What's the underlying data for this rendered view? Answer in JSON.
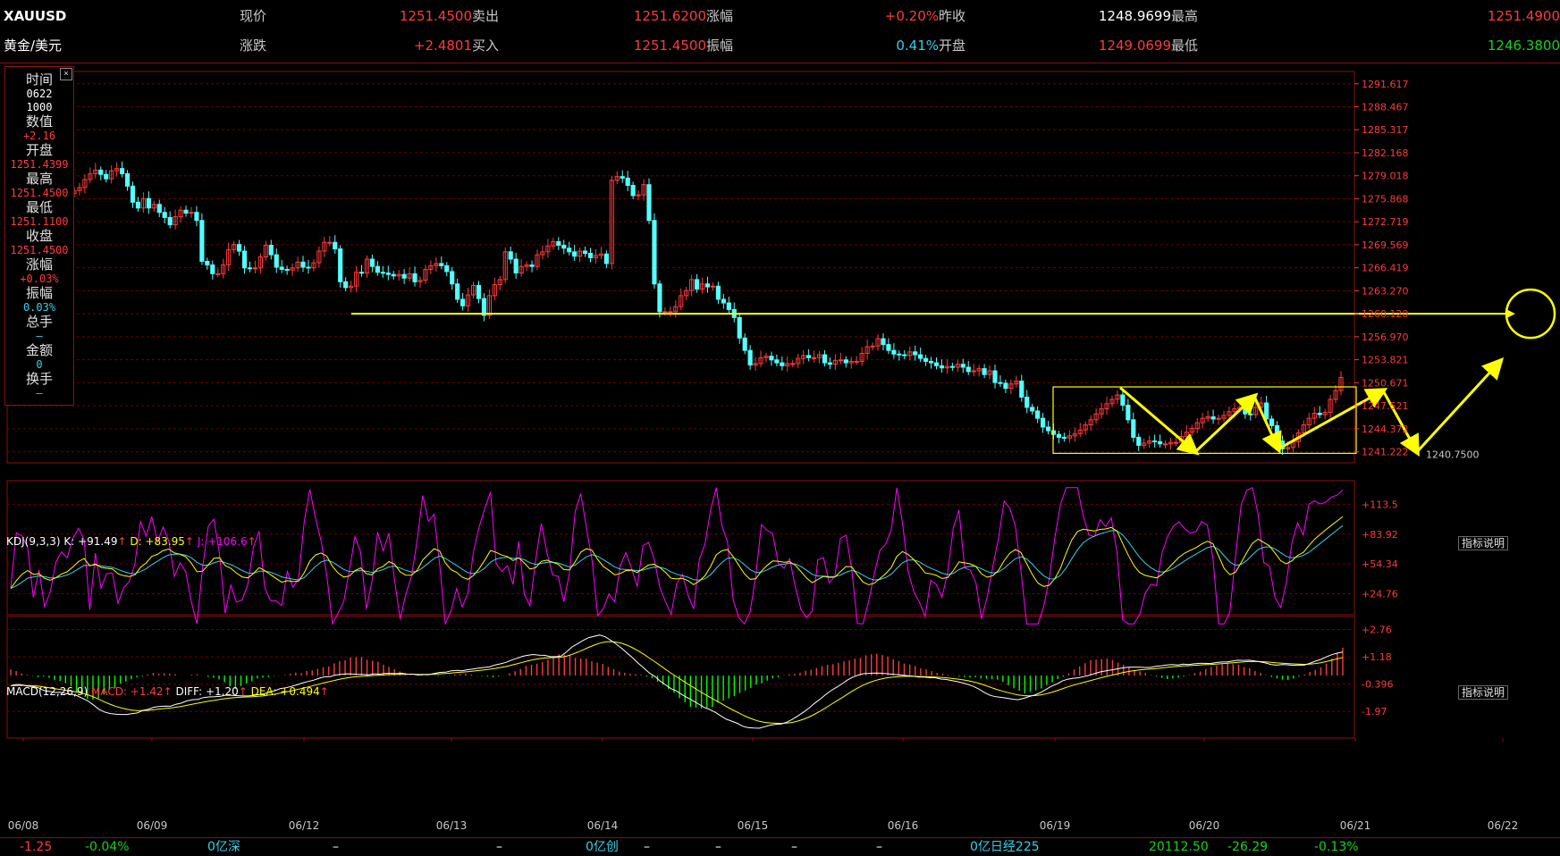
{
  "header": {
    "symbol": "XAUUSD",
    "name": "黄金/美元",
    "row1": [
      {
        "label": "现价",
        "value": "1251.4500",
        "color": "red"
      },
      {
        "label": "卖出",
        "value": "1251.6200",
        "color": "red"
      },
      {
        "label": "涨幅",
        "value": "+0.20%",
        "color": "red"
      },
      {
        "label": "昨收",
        "value": "1248.9699",
        "color": "white"
      },
      {
        "label": "最高",
        "value": "1251.4900",
        "color": "red"
      }
    ],
    "row2": [
      {
        "label": "涨跌",
        "value": "+2.4801",
        "color": "red"
      },
      {
        "label": "买入",
        "value": "1251.4500",
        "color": "red"
      },
      {
        "label": "振幅",
        "value": "0.41%",
        "color": "cyan"
      },
      {
        "label": "开盘",
        "value": "1249.0699",
        "color": "red"
      },
      {
        "label": "最低",
        "value": "1246.3800",
        "color": "green"
      }
    ]
  },
  "infobox": {
    "close_symbol": "×",
    "items": [
      {
        "label": "时间",
        "values": [
          "0622",
          "1000"
        ],
        "color": "white"
      },
      {
        "label": "数值",
        "values": [
          "+2.16"
        ],
        "color": "red"
      },
      {
        "label": "开盘",
        "values": [
          "1251.4399"
        ],
        "color": "red"
      },
      {
        "label": "最高",
        "values": [
          "1251.4500"
        ],
        "color": "red"
      },
      {
        "label": "最低",
        "values": [
          "1251.1100"
        ],
        "color": "red"
      },
      {
        "label": "收盘",
        "values": [
          "1251.4500"
        ],
        "color": "red"
      },
      {
        "label": "涨幅",
        "values": [
          "+0.03%"
        ],
        "color": "red"
      },
      {
        "label": "振幅",
        "values": [
          "0.03%"
        ],
        "color": "cyan"
      },
      {
        "label": "总手",
        "values": [
          "—"
        ],
        "color": "cyan"
      },
      {
        "label": "金额",
        "values": [
          "0"
        ],
        "color": "cyan"
      },
      {
        "label": "换手",
        "values": [
          "—"
        ],
        "color": "cyan"
      }
    ]
  },
  "chart_data": {
    "type": "candlestick",
    "price_axis_ticks": [
      "1291.617",
      "1288.467",
      "1285.317",
      "1282.168",
      "1279.018",
      "1275.868",
      "1272.719",
      "1269.569",
      "1266.419",
      "1263.270",
      "1260.120",
      "1256.970",
      "1253.821",
      "1250.671",
      "1247.521",
      "1244.372",
      "1241.222"
    ],
    "ylim": [
      1239.7,
      1293.3
    ],
    "dates": [
      "06/08",
      "06/09",
      "06/12",
      "06/13",
      "06/14",
      "06/15",
      "06/16",
      "06/19",
      "06/20",
      "06/21",
      "06/22"
    ],
    "horizontal_line_level": 1260.12,
    "low_annotation": "1240.7500",
    "closes": [
      1277.0,
      1277.4,
      1278.5,
      1279.3,
      1279.8,
      1279.2,
      1278.6,
      1279.7,
      1280.0,
      1279.3,
      1277.6,
      1275.4,
      1274.6,
      1275.9,
      1274.6,
      1275.1,
      1274.0,
      1273.3,
      1272.3,
      1273.4,
      1274.3,
      1273.9,
      1274.0,
      1272.9,
      1267.3,
      1266.8,
      1265.6,
      1265.6,
      1266.8,
      1268.9,
      1269.6,
      1268.7,
      1266.4,
      1266.3,
      1266.4,
      1267.9,
      1269.5,
      1268.2,
      1266.5,
      1266.2,
      1266.1,
      1266.4,
      1267.2,
      1266.5,
      1266.4,
      1267.1,
      1268.7,
      1269.9,
      1269.9,
      1269.0,
      1264.5,
      1263.7,
      1263.9,
      1265.8,
      1265.7,
      1267.6,
      1266.6,
      1265.8,
      1265.7,
      1265.5,
      1265.3,
      1265.5,
      1265.0,
      1265.6,
      1264.5,
      1264.7,
      1266.2,
      1266.7,
      1267.0,
      1266.7,
      1265.9,
      1264.2,
      1262.1,
      1261.2,
      1262.7,
      1264.0,
      1262.2,
      1259.9,
      1262.6,
      1264.1,
      1264.8,
      1268.6,
      1267.6,
      1265.7,
      1266.6,
      1266.8,
      1266.6,
      1268.2,
      1268.6,
      1269.4,
      1270.0,
      1269.5,
      1269.1,
      1268.6,
      1268.0,
      1268.7,
      1268.4,
      1267.8,
      1268.1,
      1268.3,
      1267.0,
      1278.4,
      1278.9,
      1278.7,
      1277.7,
      1276.3,
      1276.4,
      1277.8,
      1272.9,
      1264.2,
      1260.4,
      1260.4,
      1260.4,
      1261.1,
      1262.6,
      1263.3,
      1264.8,
      1263.5,
      1264.2,
      1263.8,
      1263.9,
      1262.1,
      1261.6,
      1260.7,
      1259.6,
      1256.8,
      1255.1,
      1253.1,
      1253.3,
      1254.1,
      1254.3,
      1253.8,
      1253.4,
      1253.0,
      1253.3,
      1253.3,
      1254.0,
      1254.4,
      1254.1,
      1254.1,
      1254.5,
      1253.4,
      1253.2,
      1253.7,
      1253.8,
      1253.4,
      1253.6,
      1253.6,
      1254.7,
      1255.6,
      1255.7,
      1256.7,
      1255.9,
      1255.1,
      1254.6,
      1254.5,
      1254.4,
      1254.9,
      1254.5,
      1254.0,
      1253.6,
      1253.4,
      1253.0,
      1252.7,
      1252.9,
      1252.8,
      1253.2,
      1252.8,
      1252.2,
      1252.3,
      1252.6,
      1251.8,
      1252.3,
      1250.7,
      1250.6,
      1249.9,
      1250.5,
      1250.9,
      1248.7,
      1247.3,
      1246.8,
      1245.8,
      1244.6,
      1244.1,
      1243.6,
      1243.2,
      1243.1,
      1243.4,
      1243.7,
      1244.2,
      1244.9,
      1245.6,
      1246.4,
      1247.1,
      1247.8,
      1248.4,
      1249.0,
      1247.6,
      1245.6,
      1243.2,
      1242.1,
      1242.4,
      1242.7,
      1242.6,
      1242.3,
      1242.3,
      1242.5,
      1242.5,
      1243.3,
      1243.9,
      1244.4,
      1245.2,
      1245.8,
      1246.0,
      1245.7,
      1245.8,
      1246.2,
      1246.7,
      1247.1,
      1247.3,
      1246.4,
      1246.3,
      1247.3,
      1247.9,
      1245.7,
      1244.8,
      1242.7,
      1241.6,
      1241.8,
      1242.6,
      1243.8,
      1244.9,
      1245.8,
      1246.5,
      1246.3,
      1246.6,
      1248.4,
      1249.6,
      1251.4
    ],
    "kdj": {
      "title": "KDJ(9,3,3)",
      "k_label": "K: +91.49",
      "d_label": "D: +83.95",
      "j_label": "J: +106.6",
      "axis_ticks": [
        "+113.5",
        "+83.92",
        "+54.34",
        "+24.76"
      ],
      "ylim": [
        4,
        128
      ],
      "k": [
        30.1,
        53.6,
        56.8,
        55.5,
        36.5,
        45.9,
        30.7,
        34.4,
        45.9,
        51.7,
        51.2,
        60.7,
        67.7,
        66.0,
        38.0,
        57.9,
        44.1,
        48.3,
        48.1,
        34.9,
        38.7,
        40.2,
        47.2,
        66.1,
        64.3,
        75.0,
        68.0,
        75.5,
        71.8,
        57.5,
        61.1,
        56.6,
        42.5,
        29.1,
        48.6,
        66.3,
        72.9,
        61.6,
        37.0,
        44.5,
        35.7,
        33.9,
        38.3,
        53.6,
        62.7,
        42.3,
        35.2,
        32.6,
        28.6,
        40.8,
        35.0,
        38.2,
        62.5,
        80.9,
        75.4,
        69.2,
        55.6,
        31.5,
        32.1,
        33.3,
        44.2,
        59.1,
        55.6,
        33.0,
        41.5,
        61.6,
        57.1,
        66.1,
        49.0,
        30.9,
        36.9,
        42.8,
        57.8,
        79.7,
        74.8,
        80.8,
        62.8,
        31.3,
        35.1,
        40.7,
        31.4,
        34.6,
        50.9,
        63.5,
        75.3,
        87.0,
        62.0,
        57.8,
        58.6,
        49.9,
        65.9,
        45.1,
        37.2,
        53.3,
        69.4,
        60.6,
        51.9,
        50.0,
        38.2,
        47.4,
        73.2,
        85.5,
        76.3,
        64.5,
        40.2,
        37.9,
        40.2,
        34.7,
        47.7,
        53.8,
        48.7,
        41.2,
        57.1,
        60.8,
        55.9,
        44.2,
        36.4,
        28.3,
        38.0,
        41.4,
        33.1,
        25.8,
        44.6,
        53.1,
        70.5,
        86.7,
        75.7,
        71.2,
        47.4,
        35.8,
        26.9,
        28.5,
        40.5,
        62.6,
        64.5,
        66.4,
        56.4,
        54.1,
        57.6,
        45.9,
        34.4,
        27.3,
        26.5,
        45.5,
        48.2,
        39.3,
        41.6,
        57.8,
        62.1,
        51.0,
        27.5,
        22.0,
        28.3,
        38.3,
        49.3,
        54.4,
        63.2,
        84.5,
        76.1,
        58.1,
        48.0,
        40.6,
        31.2,
        42.4,
        40.0,
        33.8,
        42.6,
        62.1,
        73.5,
        53.8,
        52.4,
        46.5,
        29.6,
        34.6,
        45.8,
        58.5,
        77.3,
        79.9,
        76.5,
        59.4,
        32.1,
        21.7,
        18.4,
        25.3,
        35.4,
        53.5,
        71.4,
        95.3,
        104.7,
        103.6,
        93.2,
        86.4,
        85.1,
        91.8,
        89.8,
        93.7,
        79.8,
        49.4,
        39.8,
        31.7,
        31.9,
        37.0,
        39.2,
        38.0,
        51.3,
        60.3,
        67.6,
        72.8,
        73.2,
        73.6,
        75.8,
        81.6,
        82.1,
        69.6,
        38.1,
        24.1,
        31.4,
        51.4,
        74.9,
        86.3,
        93.3,
        87.2,
        69.1,
        65.7,
        50.5,
        42.1,
        48.3,
        63.7,
        73.6,
        71.5,
        86.1,
        91.5,
        93.7,
        97.4,
        102.1,
        105.5,
        110.1
      ]
    },
    "macd": {
      "title": "MACD(12,26,9)",
      "macd_label": "MACD: +1.42",
      "diff_label": "DIFF: +1.20",
      "dea_label": "DEA: +0.494",
      "axis_ticks": [
        "+2.76",
        "+1.18",
        "-0.396",
        "-1.97"
      ],
      "ylim": [
        -3.3,
        3.3
      ],
      "hist": [
        0.32,
        0.23,
        0.11,
        0.04,
        -0.02,
        -0.08,
        -0.05,
        -0.11,
        -0.24,
        -0.28,
        -0.39,
        -0.54,
        -0.86,
        -0.97,
        -1.19,
        -1.22,
        -1.15,
        -0.97,
        -0.73,
        -0.63,
        -0.41,
        -0.3,
        -0.19,
        -0.08,
        -0.04,
        0.06,
        0.14,
        0.09,
        0.12,
        0.1,
        0.07,
        0.01,
        0.0,
        0.04,
        0.07,
        0.0,
        -0.06,
        -0.11,
        -0.2,
        -0.33,
        -0.55,
        -0.67,
        -0.54,
        -0.4,
        -0.29,
        -0.15,
        -0.1,
        -0.07,
        -0.02,
        -0.01,
        0.03,
        0.1,
        0.15,
        0.13,
        0.23,
        0.26,
        0.34,
        0.43,
        0.46,
        0.62,
        0.73,
        0.77,
        0.92,
        0.94,
        0.94,
        0.81,
        0.76,
        0.71,
        0.55,
        0.44,
        0.32,
        0.21,
        0.11,
        0.03,
        0.01,
        0.03,
        0.04,
        0.0,
        -0.03,
        -0.02,
        0.01,
        0.06,
        0.07,
        0.1,
        0.06,
        -0.01,
        -0.02,
        -0.05,
        -0.09,
        -0.04,
        0.01,
        0.11,
        0.22,
        0.33,
        0.49,
        0.55,
        0.6,
        0.68,
        0.81,
        0.93,
        1.08,
        1.05,
        1.03,
        0.91,
        0.87,
        0.86,
        0.73,
        0.66,
        0.59,
        0.44,
        0.33,
        0.21,
        0.14,
        0.09,
        0.07,
        0.04,
        -0.05,
        -0.13,
        -0.31,
        -0.46,
        -0.69,
        -0.87,
        -1.15,
        -1.35,
        -1.59,
        -1.63,
        -1.67,
        -1.64,
        -1.59,
        -1.38,
        -1.28,
        -1.16,
        -1.04,
        -0.89,
        -0.76,
        -0.63,
        -0.46,
        -0.4,
        -0.26,
        -0.14,
        -0.08,
        0.01,
        0.07,
        0.09,
        0.15,
        0.24,
        0.3,
        0.38,
        0.48,
        0.55,
        0.58,
        0.65,
        0.72,
        0.77,
        0.86,
        0.89,
        1.03,
        1.08,
        1.11,
        1.04,
        0.96,
        0.83,
        0.74,
        0.61,
        0.56,
        0.48,
        0.37,
        0.32,
        0.23,
        0.14,
        0.08,
        0.04,
        0.02,
        -0.04,
        -0.08,
        -0.1,
        -0.08,
        -0.14,
        -0.16,
        -0.18,
        -0.21,
        -0.32,
        -0.5,
        -0.65,
        -0.77,
        -0.9,
        -0.83,
        -0.75,
        -0.66,
        -0.48,
        -0.33,
        -0.18,
        -0.05,
        0.11,
        0.31,
        0.47,
        0.63,
        0.78,
        0.81,
        0.84,
        0.86,
        0.8,
        0.66,
        0.55,
        0.45,
        0.28,
        0.21,
        0.13,
        0.03,
        -0.04,
        -0.12,
        -0.18,
        -0.14,
        -0.1,
        -0.04,
        0.03,
        0.13,
        0.21,
        0.33,
        0.43,
        0.51,
        0.57,
        0.63,
        0.58,
        0.55,
        0.43,
        0.37,
        0.23,
        0.13,
        0.02,
        -0.07,
        -0.14,
        -0.21,
        -0.23,
        -0.15,
        -0.05,
        0.06,
        0.18,
        0.29,
        0.42,
        0.61,
        0.86,
        1.15,
        1.42
      ],
      "diff": [
        -0.52,
        -0.45,
        -0.47,
        -0.54,
        -0.55,
        -0.62,
        -0.76,
        -0.8,
        -0.86,
        -0.85,
        -0.92,
        -0.95,
        -1.02,
        -1.15,
        -1.29,
        -1.49,
        -1.71,
        -1.85,
        -1.93,
        -1.96,
        -1.98,
        -1.98,
        -1.94,
        -1.9,
        -1.77,
        -1.72,
        -1.61,
        -1.57,
        -1.55,
        -1.56,
        -1.46,
        -1.4,
        -1.29,
        -1.23,
        -1.21,
        -1.12,
        -1.09,
        -1.08,
        -1.06,
        -1.0,
        -1.0,
        -1.02,
        -1.04,
        -1.04,
        -1.02,
        -0.97,
        -0.93,
        -0.83,
        -0.77,
        -0.66,
        -0.62,
        -0.55,
        -0.47,
        -0.38,
        -0.3,
        -0.24,
        -0.14,
        -0.06,
        -0.06,
        0.03,
        0.06,
        0.09,
        0.08,
        0.06,
        0.06,
        0.04,
        0.09,
        0.07,
        0.11,
        0.11,
        0.1,
        0.12,
        0.07,
        0.07,
        0.03,
        0.05,
        0.05,
        0.11,
        0.16,
        0.17,
        0.24,
        0.26,
        0.24,
        0.3,
        0.33,
        0.38,
        0.41,
        0.45,
        0.54,
        0.6,
        0.67,
        0.79,
        0.88,
        0.98,
        1.04,
        1.07,
        1.04,
        1.03,
        0.96,
        0.96,
        0.99,
        1.21,
        1.46,
        1.62,
        1.79,
        1.93,
        2.0,
        2.06,
        1.97,
        1.8,
        1.6,
        1.39,
        1.14,
        0.9,
        0.63,
        0.39,
        0.14,
        -0.04,
        -0.28,
        -0.48,
        -0.67,
        -0.79,
        -0.98,
        -1.14,
        -1.29,
        -1.45,
        -1.62,
        -1.73,
        -1.87,
        -2.05,
        -2.22,
        -2.32,
        -2.43,
        -2.58,
        -2.65,
        -2.67,
        -2.68,
        -2.6,
        -2.52,
        -2.48,
        -2.46,
        -2.37,
        -2.23,
        -2.05,
        -1.87,
        -1.66,
        -1.42,
        -1.21,
        -0.98,
        -0.77,
        -0.6,
        -0.43,
        -0.23,
        -0.08,
        0.03,
        0.1,
        0.11,
        0.13,
        0.12,
        0.1,
        0.07,
        0.05,
        0.02,
        -0.01,
        -0.04,
        -0.08,
        -0.08,
        -0.11,
        -0.11,
        -0.18,
        -0.2,
        -0.26,
        -0.31,
        -0.38,
        -0.46,
        -0.56,
        -0.7,
        -0.88,
        -1.01,
        -1.08,
        -1.11,
        -1.15,
        -1.2,
        -1.23,
        -1.16,
        -1.07,
        -0.99,
        -0.88,
        -0.72,
        -0.55,
        -0.44,
        -0.28,
        -0.19,
        -0.14,
        -0.11,
        -0.05,
        0.02,
        0.11,
        0.19,
        0.24,
        0.29,
        0.34,
        0.39,
        0.42,
        0.43,
        0.43,
        0.41,
        0.41,
        0.47,
        0.5,
        0.54,
        0.56,
        0.54,
        0.58,
        0.56,
        0.6,
        0.62,
        0.62,
        0.61,
        0.66,
        0.69,
        0.7,
        0.74,
        0.78,
        0.77,
        0.78,
        0.74,
        0.7,
        0.64,
        0.56,
        0.53,
        0.56,
        0.55,
        0.52,
        0.54,
        0.53,
        0.62,
        0.73,
        0.82,
        0.95,
        1.06,
        1.14,
        1.2
      ]
    }
  },
  "footer": [
    {
      "text": "-1.25",
      "color": "red"
    },
    {
      "text": "-0.04%",
      "color": "green"
    },
    {
      "text": "0亿深",
      "color": "cyan"
    },
    {
      "text": "–",
      "color": "white"
    },
    {
      "text": "–",
      "color": "white"
    },
    {
      "text": "–",
      "color": "white"
    },
    {
      "text": "0亿创",
      "color": "cyan"
    },
    {
      "text": "–",
      "color": "white"
    },
    {
      "text": "–",
      "color": "white"
    },
    {
      "text": "–",
      "color": "white"
    },
    {
      "text": "0亿日经225",
      "color": "cyan"
    },
    {
      "text": "20112.50",
      "color": "green"
    },
    {
      "text": "-26.29",
      "color": "green"
    },
    {
      "text": "-0.13%",
      "color": "green"
    }
  ],
  "buttons": {
    "indicator_help": "指标说明"
  },
  "colors": {
    "up": "#ff3b3b",
    "down": "#54ffff",
    "grid": "#6e0000",
    "k": "#ffffff",
    "d": "#ffff00",
    "j": "#ff00ff",
    "dea": "#ffff00",
    "diff": "#ffffff",
    "hist_up": "#ff3b3b",
    "hist_down": "#00ff00"
  }
}
